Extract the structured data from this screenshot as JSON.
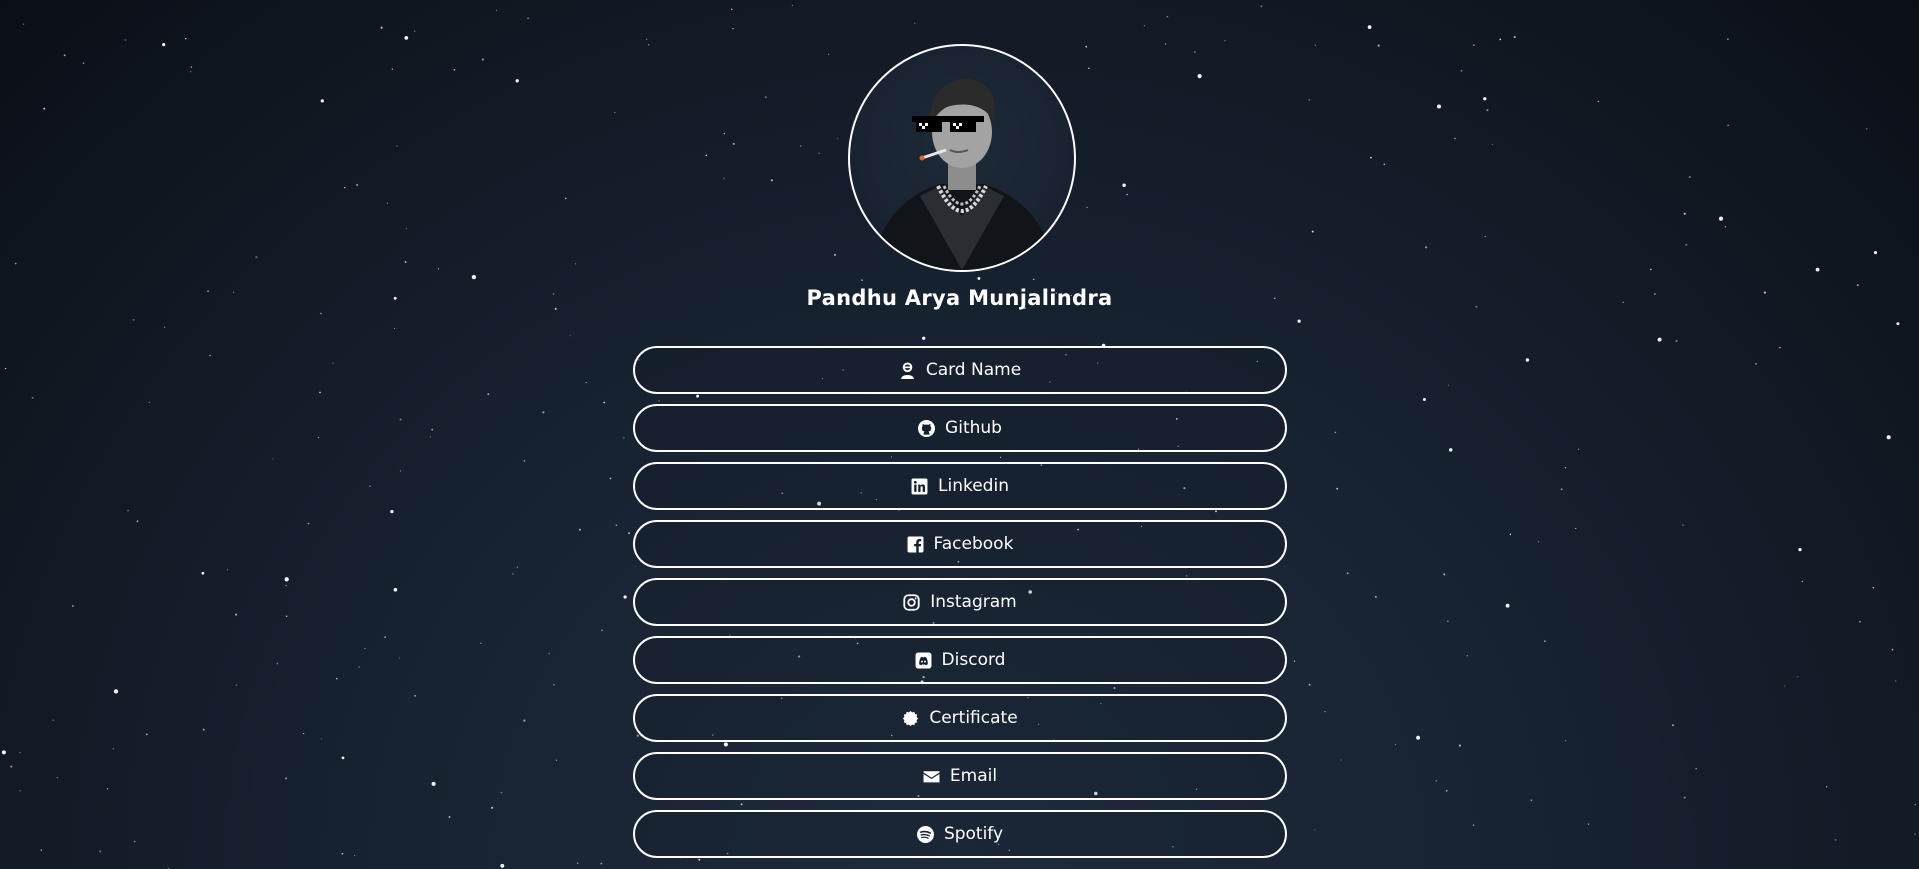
{
  "profile": {
    "name": "Pandhu Arya Munjalindra"
  },
  "links": [
    {
      "label": "Card Name",
      "icon": "user-card-icon"
    },
    {
      "label": "Github",
      "icon": "github-icon"
    },
    {
      "label": "Linkedin",
      "icon": "linkedin-icon"
    },
    {
      "label": "Facebook",
      "icon": "facebook-icon"
    },
    {
      "label": "Instagram",
      "icon": "instagram-icon"
    },
    {
      "label": "Discord",
      "icon": "discord-icon"
    },
    {
      "label": "Certificate",
      "icon": "certificate-icon"
    },
    {
      "label": "Email",
      "icon": "envelope-icon"
    },
    {
      "label": "Spotify",
      "icon": "spotify-icon"
    }
  ],
  "colors": {
    "background_center": "#1e2b3c",
    "background_edge": "#0b0f15",
    "button_border": "#ffffff",
    "text": "#ffffff"
  }
}
